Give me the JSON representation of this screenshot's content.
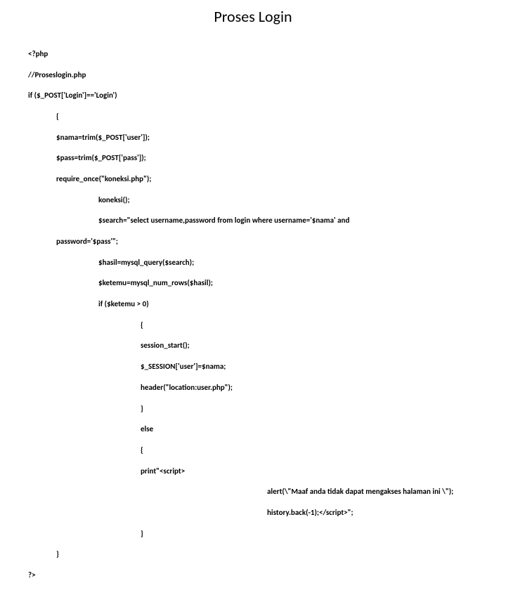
{
  "title": "Proses Login",
  "code": {
    "l01": "<?php",
    "l02": "//Proseslogin.php",
    "l03": "if ($_POST['Login']=='Login')",
    "l04": "{",
    "l05": "$nama=trim($_POST['user']);",
    "l06": "$pass=trim($_POST['pass']);",
    "l07": "require_once(\"koneksi.php\");",
    "l08": "koneksi();",
    "l09": "$search=\"select username,password from login where username='$nama' and",
    "l10": "password='$pass'\";",
    "l11": "$hasil=mysql_query($search);",
    "l12": "$ketemu=mysql_num_rows($hasil);",
    "l13": "if ($ketemu > 0)",
    "l14": "{",
    "l15": "session_start();",
    "l16": "$_SESSION['user']=$nama;",
    "l17": "header(\"location:user.php\");",
    "l18": "}",
    "l19": "else",
    "l20": "{",
    "l21": "print\"<script>",
    "l22": "alert(\\\"Maaf anda tidak dapat mengakses halaman ini \\\");",
    "l23": "history.back(-1);</script>\";",
    "l24": "}",
    "l25": "}",
    "l26": "?>"
  }
}
